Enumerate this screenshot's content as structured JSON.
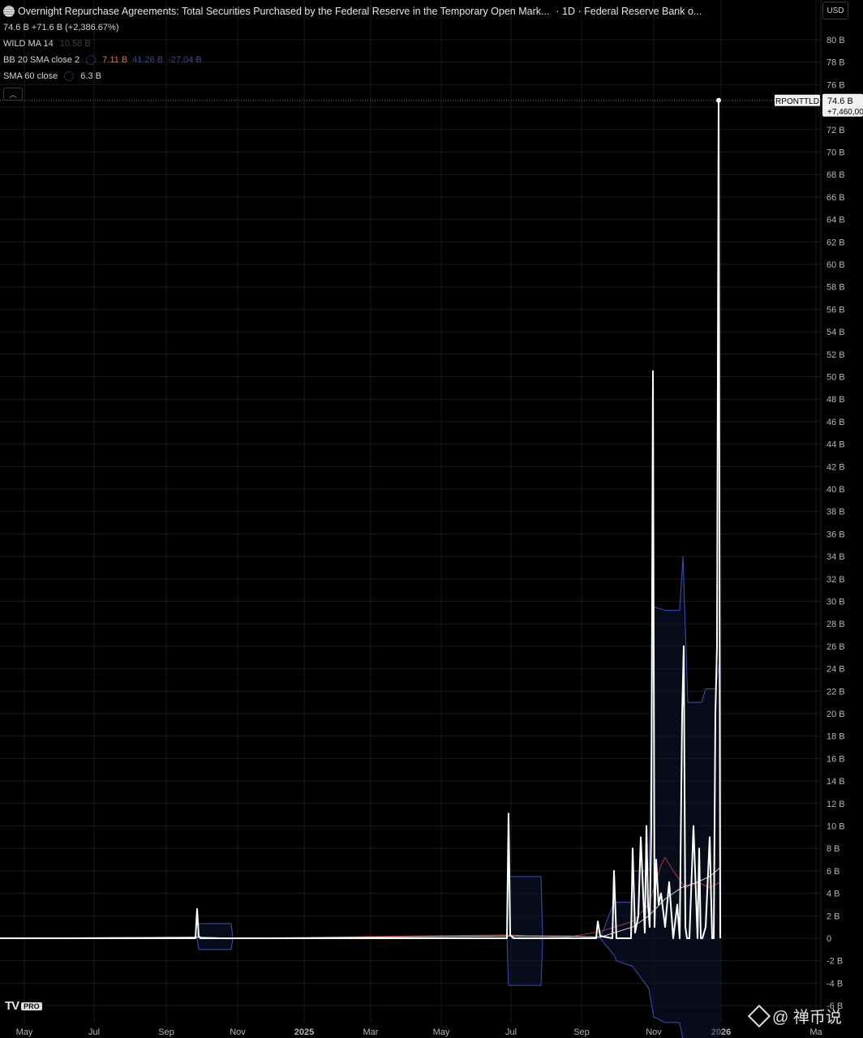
{
  "header": {
    "title": "Overnight Repurchase Agreements: Total Securities Purchased by the Federal Reserve in the Temporary Open Mark...",
    "title_suffix": "· 1D · Federal Reserve Bank o...",
    "price_line": "74.6 B  +71.6 B (+2,386.67%)"
  },
  "indicators": [
    {
      "label": "WILD MA 14",
      "value": "10.58 B"
    },
    {
      "label": "BB 20 SMA close 2",
      "values": [
        "7.11 B",
        "41.26 B",
        "-27.04 B"
      ]
    },
    {
      "label": "SMA 60 close",
      "value": "6.3 B"
    }
  ],
  "currency": "USD",
  "price_label": {
    "symbol": "RPONTTLD",
    "value": "74.6 B",
    "change": "+7,460,00"
  },
  "watermark": "@ 禅币说",
  "branding": {
    "logo": "TV",
    "tier": "PRO"
  },
  "colors": {
    "background": "#000000",
    "price_line": "#ffffff",
    "bb_band": "#3f4fb8",
    "wild_ma": "#b03a2e",
    "sma60": "#d0d0d0",
    "grid": "#1a1a1a"
  },
  "chart_data": {
    "type": "line",
    "title": "Overnight Repurchase Agreements: Total Securities Purchased by the Federal Reserve in the Temporary Open Market Operations",
    "y_unit": "B",
    "ylim": [
      -6,
      82
    ],
    "grid": true,
    "x_ticks": [
      "May",
      "Jul",
      "Sep",
      "Nov",
      "2025",
      "Mar",
      "May",
      "Jul",
      "Sep",
      "Nov",
      "2026",
      "Ma"
    ],
    "y_ticks": [
      "80 B",
      "78 B",
      "76 B",
      "74 B",
      "72 B",
      "70 B",
      "68 B",
      "66 B",
      "64 B",
      "62 B",
      "60 B",
      "58 B",
      "56 B",
      "54 B",
      "52 B",
      "50 B",
      "48 B",
      "46 B",
      "44 B",
      "42 B",
      "40 B",
      "38 B",
      "36 B",
      "34 B",
      "32 B",
      "30 B",
      "28 B",
      "26 B",
      "24 B",
      "22 B",
      "20 B",
      "18 B",
      "16 B",
      "14 B",
      "12 B",
      "10 B",
      "8 B",
      "6 B",
      "4 B",
      "2 B",
      "0",
      "-2 B",
      "-4 B",
      "-6 B"
    ],
    "series": [
      {
        "name": "RPONTTLD",
        "x": [
          0,
          241,
          243,
          245,
          247,
          250,
          625,
          627,
          629,
          633,
          735,
          737,
          740,
          755,
          757,
          760,
          778,
          780,
          783,
          787,
          790,
          795,
          797,
          799,
          801,
          803,
          805,
          807,
          809,
          812,
          815,
          820,
          825,
          830,
          835,
          838,
          841,
          843,
          845,
          847,
          850,
          855,
          860,
          862,
          864,
          866,
          870,
          875,
          878,
          880,
          882,
          884,
          886,
          888
        ],
        "y": [
          0,
          0,
          2.6,
          0.2,
          0,
          0,
          0,
          11.1,
          0.3,
          0,
          0,
          1.5,
          0.2,
          0,
          6,
          0,
          0,
          8,
          0.5,
          2,
          9,
          0.5,
          10,
          3,
          1,
          10,
          50.5,
          1,
          7,
          3,
          4,
          1,
          5,
          0,
          3,
          0,
          20,
          26,
          1,
          0,
          0,
          10,
          0,
          8,
          0,
          0,
          1,
          9,
          0,
          0,
          20,
          26,
          74.6,
          0
        ]
      },
      {
        "name": "BB upper",
        "x": [
          0,
          243,
          245,
          285,
          287,
          625,
          627,
          667,
          669,
          740,
          757,
          760,
          778,
          780,
          800,
          806,
          820,
          838,
          842,
          848,
          865,
          870,
          882,
          888
        ],
        "y": [
          0,
          0,
          1.3,
          1.3,
          0,
          0,
          5.5,
          5.5,
          0,
          0,
          3.2,
          3.2,
          3.2,
          6,
          6,
          29.5,
          29.2,
          29.2,
          34,
          21,
          21,
          22.2,
          22.2,
          25
        ]
      },
      {
        "name": "BB lower",
        "x": [
          0,
          243,
          245,
          285,
          287,
          625,
          627,
          667,
          669,
          740,
          757,
          760,
          780,
          800,
          806,
          820,
          838,
          842,
          865,
          882,
          888
        ],
        "y": [
          0,
          0,
          -1,
          -1,
          0,
          0,
          -4.2,
          -4.2,
          0,
          0,
          -1.5,
          -2,
          -2.5,
          -4.5,
          -7,
          -7.5,
          -7.5,
          -9,
          -9,
          -9,
          -9
        ]
      },
      {
        "name": "WILD MA 14",
        "x": [
          0,
          245,
          285,
          625,
          660,
          700,
          740,
          780,
          800,
          815,
          820,
          830,
          845,
          860,
          875,
          888
        ],
        "y": [
          0,
          0.1,
          0,
          0.3,
          0.2,
          0.1,
          0.6,
          1.5,
          3,
          6.5,
          7.2,
          6,
          4.5,
          5,
          4.5,
          5
        ]
      },
      {
        "name": "SMA 60 close",
        "x": [
          0,
          245,
          285,
          625,
          700,
          740,
          780,
          800,
          820,
          840,
          860,
          875,
          888
        ],
        "y": [
          0,
          0.1,
          0,
          0.2,
          0.2,
          0.1,
          1,
          2,
          3.5,
          4.5,
          5,
          5.5,
          6.3
        ]
      }
    ]
  }
}
